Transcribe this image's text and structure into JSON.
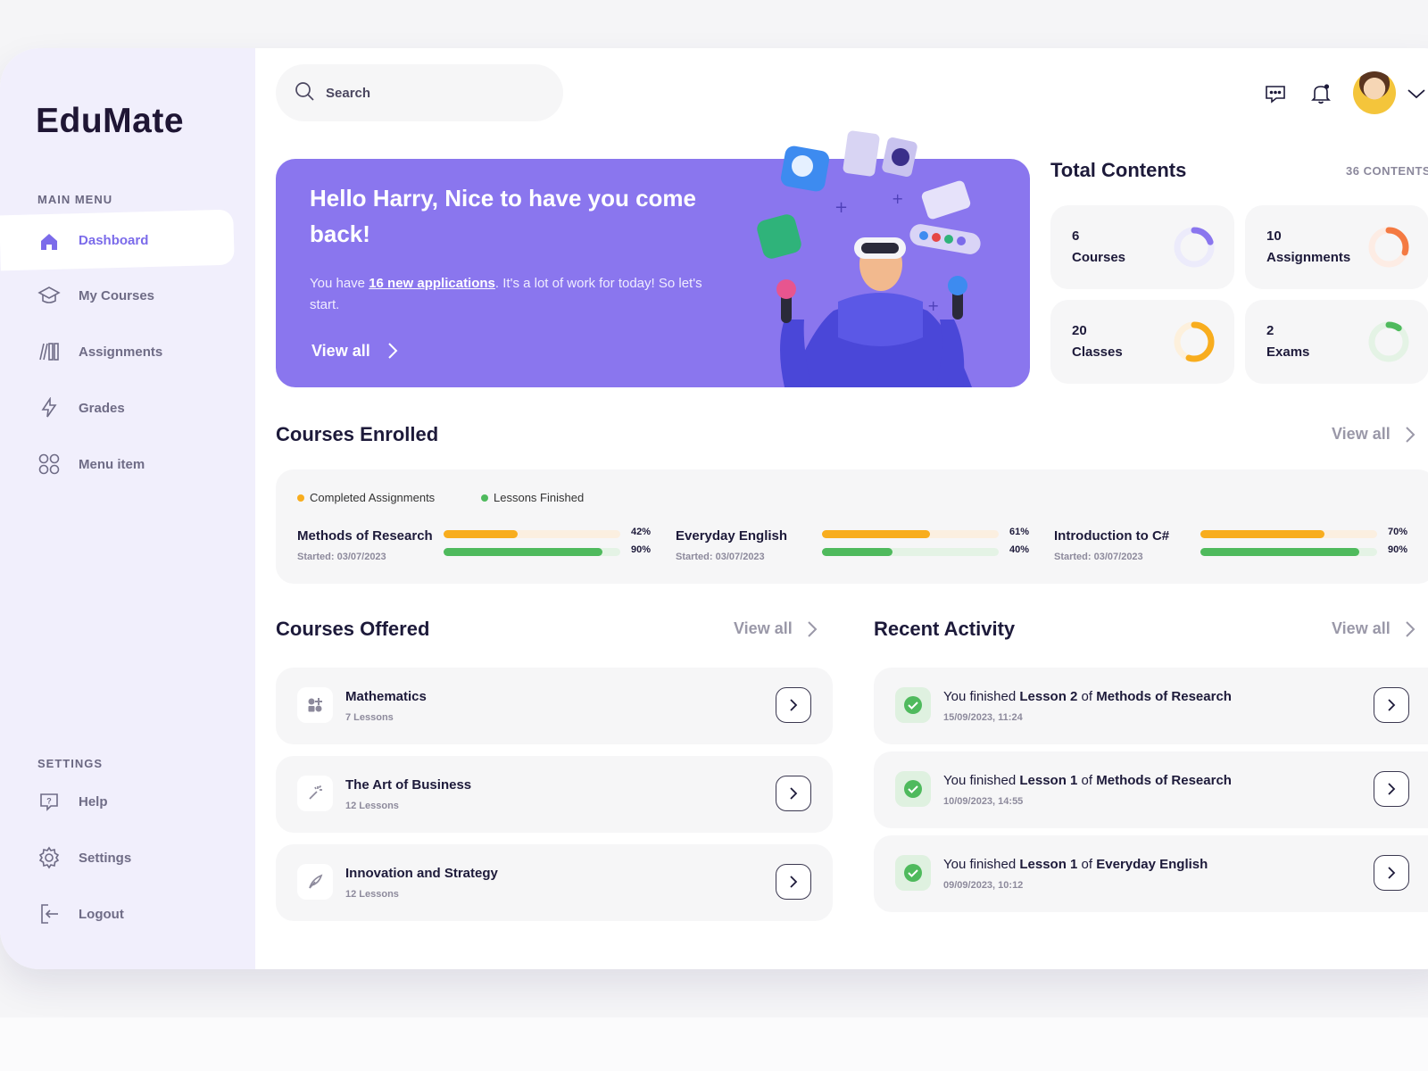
{
  "app": {
    "name": "EduMate"
  },
  "sidebar": {
    "main_menu_label": "MAIN MENU",
    "items": [
      {
        "label": "Dashboard",
        "icon": "home-icon",
        "active": true
      },
      {
        "label": "My Courses",
        "icon": "graduation-cap-icon"
      },
      {
        "label": "Assignments",
        "icon": "books-icon"
      },
      {
        "label": "Grades",
        "icon": "lightning-icon"
      },
      {
        "label": "Menu item",
        "icon": "grid-icon"
      }
    ],
    "settings_label": "SETTINGS",
    "settings_items": [
      {
        "label": "Help",
        "icon": "help-icon"
      },
      {
        "label": "Settings",
        "icon": "gear-icon"
      },
      {
        "label": "Logout",
        "icon": "logout-icon"
      }
    ]
  },
  "header": {
    "search_placeholder": "Search"
  },
  "hero": {
    "title": "Hello Harry, Nice to have you come back!",
    "text_before": "You have ",
    "link": "16 new applications",
    "text_after": ". It's a lot of work for today! So let's start.",
    "button": "View all"
  },
  "total_contents": {
    "title": "Total Contents",
    "count": "36 CONTENTS",
    "cards": [
      {
        "num": "6",
        "label": "Courses",
        "progress": 0.2,
        "color": "#8a76ee",
        "track": "#ecebfb"
      },
      {
        "num": "10",
        "label": "Assignments",
        "progress": 0.3,
        "color": "#f47a42",
        "track": "#fdece4"
      },
      {
        "num": "20",
        "label": "Classes",
        "progress": 0.55,
        "color": "#f8ad1e",
        "track": "#fdf0dc"
      },
      {
        "num": "2",
        "label": "Exams",
        "progress": 0.1,
        "color": "#4fba5d",
        "track": "#e4f3e5"
      }
    ]
  },
  "enrolled": {
    "title": "Courses Enrolled",
    "view_all": "View all",
    "legend": [
      {
        "label": "Completed Assignments",
        "color": "#f8ad1e"
      },
      {
        "label": "Lessons Finished",
        "color": "#4fba5d"
      }
    ],
    "courses": [
      {
        "name": "Methods of Research",
        "started": "Started: 03/07/2023",
        "assign_pct": 42,
        "assign_label": "42%",
        "lesson_pct": 90,
        "lesson_label": "90%"
      },
      {
        "name": "Everyday English",
        "started": "Started: 03/07/2023",
        "assign_pct": 61,
        "assign_label": "61%",
        "lesson_pct": 40,
        "lesson_label": "40%"
      },
      {
        "name": "Introduction to C#",
        "started": "Started: 03/07/2023",
        "assign_pct": 70,
        "assign_label": "70%",
        "lesson_pct": 90,
        "lesson_label": "90%"
      }
    ]
  },
  "offered": {
    "title": "Courses Offered",
    "view_all": "View all",
    "items": [
      {
        "name": "Mathematics",
        "lessons": "7 Lessons",
        "icon": "shapes-icon"
      },
      {
        "name": "The Art of Business",
        "lessons": "12 Lessons",
        "icon": "magic-wand-icon"
      },
      {
        "name": "Innovation and Strategy",
        "lessons": "12 Lessons",
        "icon": "feather-icon"
      }
    ]
  },
  "activity": {
    "title": "Recent Activity",
    "view_all": "View all",
    "items": [
      {
        "prefix": "You finished ",
        "lesson": "Lesson 2",
        "of": " of ",
        "course": "Methods of Research",
        "time": "15/09/2023, 11:24"
      },
      {
        "prefix": "You finished ",
        "lesson": "Lesson 1",
        "of": " of ",
        "course": "Methods of Research",
        "time": "10/09/2023, 14:55"
      },
      {
        "prefix": "You finished ",
        "lesson": "Lesson 1",
        "of": " of ",
        "course": "Everyday English",
        "time": "09/09/2023, 10:12"
      }
    ]
  }
}
